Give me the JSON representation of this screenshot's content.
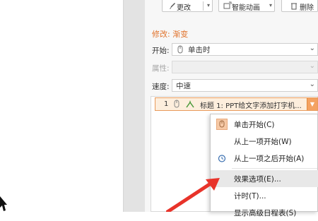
{
  "toolbar": {
    "change_label": "更改",
    "smart_animation_label": "智能动画",
    "delete_label": "删除"
  },
  "panel": {
    "section_title": "修改: 渐变",
    "start_label": "开始:",
    "start_value": "单击时",
    "property_label": "属性:",
    "property_value": "",
    "speed_label": "速度:",
    "speed_value": "中速"
  },
  "animation_list": {
    "items": [
      {
        "number": "1",
        "label": "标题 1: PPT给文字添加打字机..."
      }
    ]
  },
  "context_menu": {
    "items": [
      {
        "label": "单击开始(C)",
        "icon": "mouse-click-icon"
      },
      {
        "label": "从上一项开始(W)",
        "icon": ""
      },
      {
        "label": "从上一项之后开始(A)",
        "icon": "clock-icon"
      },
      {
        "label": "效果选项(E)...",
        "icon": ""
      },
      {
        "label": "计时(T)...",
        "icon": ""
      },
      {
        "label": "显示高级日程表(S)",
        "icon": ""
      }
    ]
  },
  "colors": {
    "accent_orange": "#e0722b",
    "selected_item_bg": "#fdeedd",
    "annotation_arrow": "#e8332a"
  }
}
